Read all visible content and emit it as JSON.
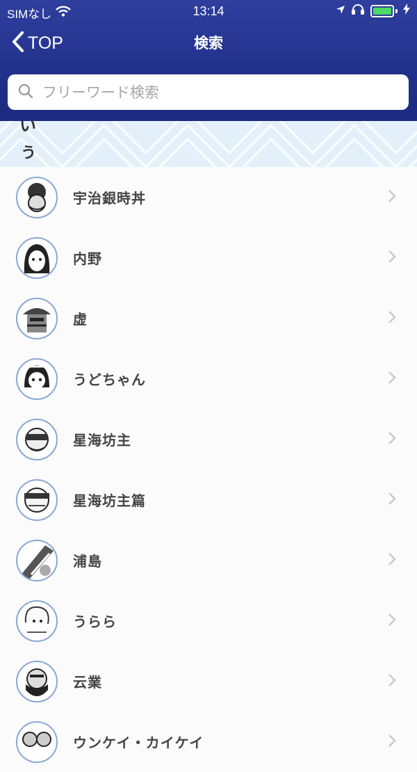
{
  "status_bar": {
    "carrier": "SIMなし",
    "time": "13:14"
  },
  "nav": {
    "back_label": "TOP",
    "title": "検索"
  },
  "search": {
    "placeholder": "フリーワード検索"
  },
  "section": {
    "prev_letter": "い",
    "letter": "う"
  },
  "items": [
    {
      "name": "宇治銀時丼",
      "icon": "character-avatar-icon"
    },
    {
      "name": "内野",
      "icon": "character-avatar-icon"
    },
    {
      "name": "虚",
      "icon": "character-avatar-icon"
    },
    {
      "name": "うどちゃん",
      "icon": "character-avatar-icon"
    },
    {
      "name": "星海坊主",
      "icon": "character-avatar-icon"
    },
    {
      "name": "星海坊主篇",
      "icon": "character-avatar-icon"
    },
    {
      "name": "浦島",
      "icon": "character-avatar-icon"
    },
    {
      "name": "うらら",
      "icon": "character-avatar-icon"
    },
    {
      "name": "云業",
      "icon": "character-avatar-icon"
    },
    {
      "name": "ウンケイ・カイケイ",
      "icon": "character-avatar-icon"
    }
  ],
  "colors": {
    "header": "#22328c",
    "band": "#e3f0f9",
    "battery": "#4cd964",
    "avatar_border": "#8aa7d6"
  }
}
